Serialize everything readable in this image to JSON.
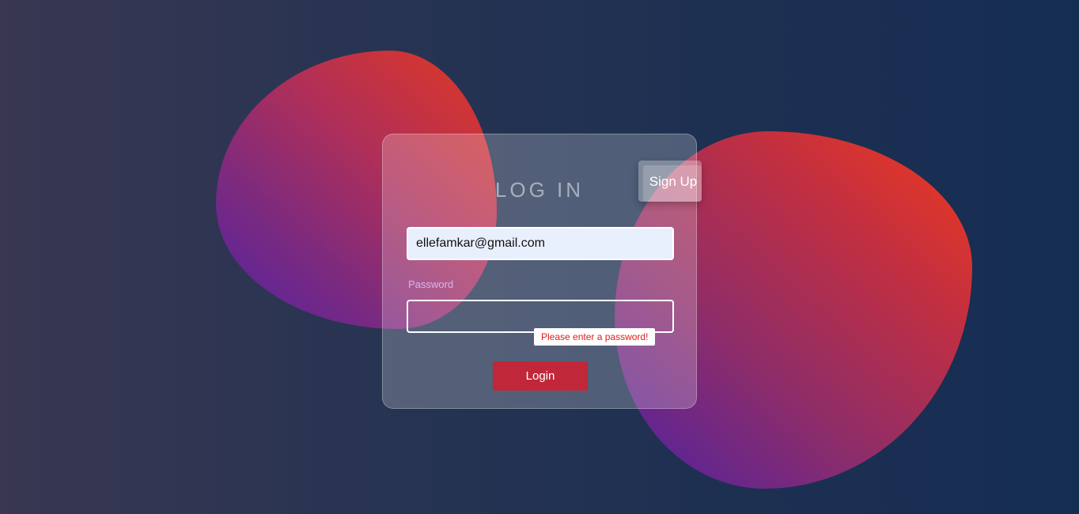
{
  "login_form": {
    "title": "LOG IN",
    "email": {
      "value": "ellefamkar@gmail.com"
    },
    "password": {
      "label": "Password",
      "value": "",
      "validation_message": "Please enter a password!"
    },
    "login_button": "Login",
    "signup_button": "Sign Up"
  },
  "colors": {
    "login_button": "#c0283a",
    "validation_text": "#e11a1a",
    "password_label": "#d8b6ea",
    "email_field_bg": "#e8effd"
  }
}
